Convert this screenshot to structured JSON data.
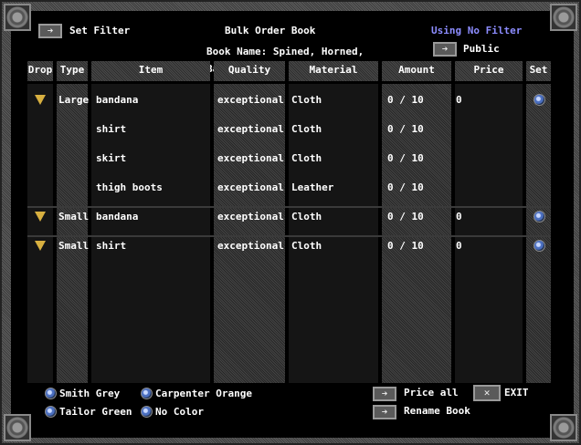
{
  "title": "Bulk Order Book",
  "book_name": "Book Name: Spined, Horned, Barbed",
  "set_filter": "Set Filter",
  "filter_status": "Using No Filter",
  "public_label": "Public",
  "columns": [
    "Drop",
    "Type",
    "Item",
    "Quality",
    "Material",
    "Amount",
    "Price",
    "Set"
  ],
  "rows": [
    {
      "type": "Large",
      "item": "bandana",
      "quality": "exceptional",
      "material": "Cloth",
      "amount": "0 / 10",
      "price": "0"
    },
    {
      "type": "",
      "item": "shirt",
      "quality": "exceptional",
      "material": "Cloth",
      "amount": "0 / 10",
      "price": ""
    },
    {
      "type": "",
      "item": "skirt",
      "quality": "exceptional",
      "material": "Cloth",
      "amount": "0 / 10",
      "price": ""
    },
    {
      "type": "",
      "item": "thigh boots",
      "quality": "exceptional",
      "material": "Leather",
      "amount": "0 / 10",
      "price": ""
    },
    {
      "type": "Small",
      "item": "bandana",
      "quality": "exceptional",
      "material": "Cloth",
      "amount": "0 / 10",
      "price": "0"
    },
    {
      "type": "Small",
      "item": "shirt",
      "quality": "exceptional",
      "material": "Cloth",
      "amount": "0 / 10",
      "price": "0"
    }
  ],
  "hue_options": {
    "smith": "Smith Grey",
    "carpenter": "Carpenter Orange",
    "tailor": "Tailor Green",
    "none": "No Color"
  },
  "actions": {
    "price_all": "Price all",
    "rename": "Rename Book",
    "exit": "EXIT"
  },
  "colors": {
    "filter_text": "#8c8cff",
    "accent_triangle": "#d8b040"
  },
  "icons": {
    "arrow": "arrow-right-icon",
    "close": "x-icon",
    "gem": "blue-gem-icon",
    "drop": "triangle-down-icon"
  }
}
